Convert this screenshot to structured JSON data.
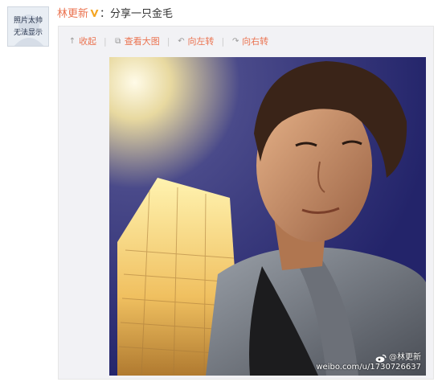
{
  "avatar": {
    "line1": "照片太帅",
    "line2": "无法显示"
  },
  "header": {
    "username": "林更新",
    "separator": "：",
    "status_text": "分享一只金毛"
  },
  "toolbar": {
    "collapse": {
      "label": "收起",
      "icon": "arrow-up-icon"
    },
    "view_large": {
      "label": "查看大图",
      "icon": "view-large-icon"
    },
    "rotate_left": {
      "label": "向左转",
      "icon": "rotate-left-icon"
    },
    "rotate_right": {
      "label": "向右转",
      "icon": "rotate-right-icon"
    }
  },
  "photo": {
    "watermark_user": "@林更新",
    "watermark_url": "weibo.com/u/1730726637"
  },
  "colors": {
    "accent": "#eb7350",
    "card_bg": "#f2f2f5",
    "verified_badge": "#f5a623"
  }
}
